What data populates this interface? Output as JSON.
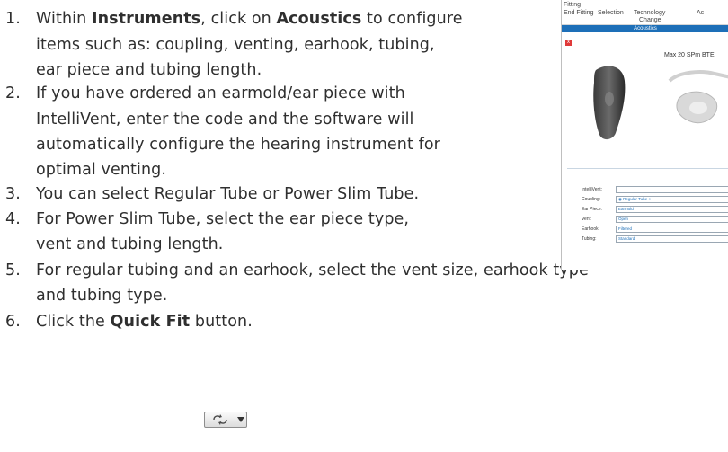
{
  "steps": [
    {
      "num": "1.",
      "lines": [
        [
          "Within ",
          {
            "b": "Instruments"
          },
          ", click on ",
          {
            "b": "Acoustics"
          },
          " to configure"
        ],
        [
          "items such as: coupling, venting, earhook, tubing,"
        ],
        [
          "ear piece and tubing length."
        ]
      ]
    },
    {
      "num": "2.",
      "lines": [
        [
          "If you have ordered an earmold/ear piece with"
        ],
        [
          "IntelliVent, enter the code and the software will"
        ],
        [
          "automatically configure the hearing instrument for"
        ],
        [
          "optimal venting."
        ]
      ]
    },
    {
      "num": "3.",
      "lines": [
        [
          "You can select Regular Tube or Power Slim Tube."
        ]
      ]
    },
    {
      "num": "4.",
      "lines": [
        [
          "For Power Slim Tube, select the ear piece type,"
        ],
        [
          "vent and tubing length."
        ]
      ]
    },
    {
      "num": "5.",
      "lines": [
        [
          "For regular tubing and an earhook, select the vent size, earhook type"
        ],
        [
          "and tubing type."
        ]
      ]
    },
    {
      "num": "6.",
      "lines": [
        [
          "Click the ",
          {
            "b": "Quick Fit"
          },
          " button."
        ]
      ]
    }
  ],
  "screenshot": {
    "menu_left_1": "Fitting",
    "menu_left_2": "End Fitting",
    "menu_selection": "Selection",
    "menu_tech": "Technology",
    "menu_change": "Change",
    "menu_ac": "Ac",
    "tab_label": "Acoustics",
    "close_glyph": "x",
    "model_name": "Max 20 SPm BTE",
    "fields": [
      {
        "label": "IntelliVent:",
        "value": ""
      },
      {
        "label": "Coupling:",
        "value": "◉ Regular Tube  ○"
      },
      {
        "label": "Ear Piece:",
        "value": "Earmold"
      },
      {
        "label": "Vent:",
        "value": "Open"
      },
      {
        "label": "Earhook:",
        "value": "Filtered"
      },
      {
        "label": "Tubing:",
        "value": "Standard"
      }
    ]
  },
  "colors": {
    "accent": "#1d6fb8",
    "text": "#2f2f2f"
  }
}
